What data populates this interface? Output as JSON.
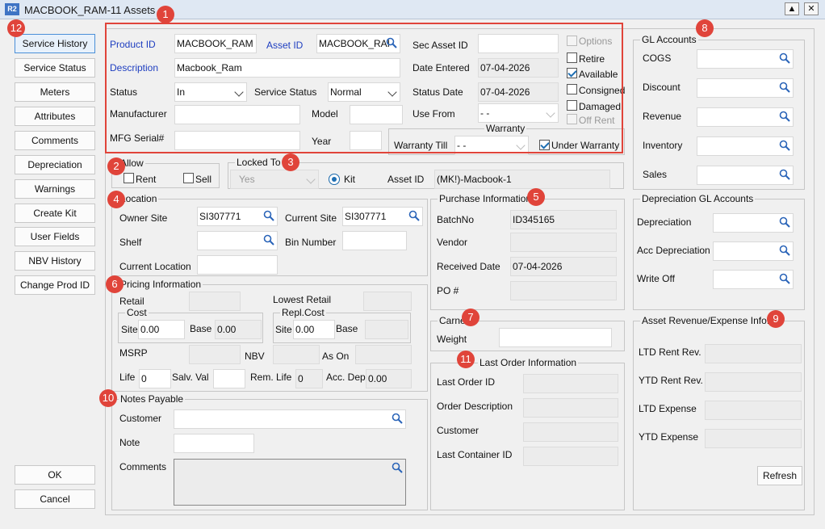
{
  "window": {
    "title": "MACBOOK_RAM-11 Assets",
    "app_icon": "R2"
  },
  "nav": [
    "Service History",
    "Service Status",
    "Meters",
    "Attributes",
    "Comments",
    "Depreciation",
    "Warnings",
    "Create Kit",
    "User Fields",
    "NBV History",
    "Change Prod ID"
  ],
  "actions": {
    "ok": "OK",
    "cancel": "Cancel"
  },
  "product": {
    "product_id_label": "Product ID",
    "product_id": "MACBOOK_RAM",
    "asset_id_label": "Asset ID",
    "asset_id": "MACBOOK_RAI",
    "sec_asset_label": "Sec Asset ID",
    "sec_asset": "",
    "description_label": "Description",
    "description": "Macbook_Ram",
    "date_entered_label": "Date Entered",
    "date_entered": "07-04-2026",
    "status_label": "Status",
    "status": "In",
    "service_status_label": "Service Status",
    "service_status": "Normal",
    "status_date_label": "Status Date",
    "status_date": "07-04-2026",
    "manufacturer_label": "Manufacturer",
    "model_label": "Model",
    "use_from_label": "Use From",
    "use_from": "- -",
    "mfg_serial_label": "MFG Serial#",
    "year_label": "Year",
    "warranty_label": "Warranty",
    "warranty_till_label": "Warranty Till",
    "warranty_till": "- -",
    "under_warranty_label": "Under Warranty"
  },
  "flags": {
    "options": "Options",
    "retire": "Retire",
    "available": "Available",
    "consigned": "Consigned",
    "damaged": "Damaged",
    "off_rent": "Off Rent"
  },
  "allow": {
    "title": "Allow",
    "rent": "Rent",
    "sell": "Sell"
  },
  "locked": {
    "title": "Locked To",
    "value": "Yes",
    "kit": "Kit",
    "asset_id_label": "Asset ID",
    "asset_id": "(MK!)-Macbook-1"
  },
  "location": {
    "title": "Location",
    "owner_site_label": "Owner Site",
    "owner_site": "SI307771",
    "current_site_label": "Current Site",
    "current_site": "SI307771",
    "shelf_label": "Shelf",
    "bin_label": "Bin Number",
    "current_location_label": "Current Location"
  },
  "purchase": {
    "title": "Purchase Information",
    "batch_label": "BatchNo",
    "batch": "ID345165",
    "vendor_label": "Vendor",
    "received_label": "Received Date",
    "received": "07-04-2026",
    "po_label": "PO #"
  },
  "pricing": {
    "title": "Pricing Information",
    "retail_label": "Retail",
    "lowest_retail_label": "Lowest Retail",
    "cost_label": "Cost",
    "site_label": "Site",
    "cost_site": "0.00",
    "base_label": "Base",
    "cost_base": "0.00",
    "repl_label": "Repl.Cost",
    "repl_site": "0.00",
    "msrp_label": "MSRP",
    "nbv_label": "NBV",
    "as_on_label": "As On",
    "life_label": "Life",
    "life": "0",
    "salv_label": "Salv. Val",
    "rem_life_label": "Rem. Life",
    "rem_life": "0",
    "acc_dep_label": "Acc. Dep",
    "acc_dep": "0.00"
  },
  "carnet": {
    "title": "Carnet",
    "weight_label": "Weight"
  },
  "last_order": {
    "title": "Last Order Information",
    "id_label": "Last Order ID",
    "desc_label": "Order Description",
    "customer_label": "Customer",
    "container_label": "Last Container ID"
  },
  "notes": {
    "title": "Notes Payable",
    "customer_label": "Customer",
    "note_label": "Note",
    "comments_label": "Comments"
  },
  "gl": {
    "title": "GL Accounts",
    "items": [
      "COGS",
      "Discount",
      "Revenue",
      "Inventory",
      "Sales"
    ]
  },
  "dep_gl": {
    "title": "Depreciation GL Accounts",
    "items": [
      "Depreciation",
      "Acc Depreciation",
      "Write Off"
    ]
  },
  "rev": {
    "title": "Asset Revenue/Expense Info.",
    "items": [
      "LTD Rent Rev.",
      "YTD Rent Rev.",
      "LTD Expense",
      "YTD Expense"
    ],
    "refresh": "Refresh"
  },
  "badges": [
    "1",
    "2",
    "3",
    "4",
    "5",
    "6",
    "7",
    "8",
    "9",
    "10",
    "11",
    "12"
  ],
  "colors": {
    "accent": "#1e3ec0",
    "annotation": "#e0443a"
  }
}
